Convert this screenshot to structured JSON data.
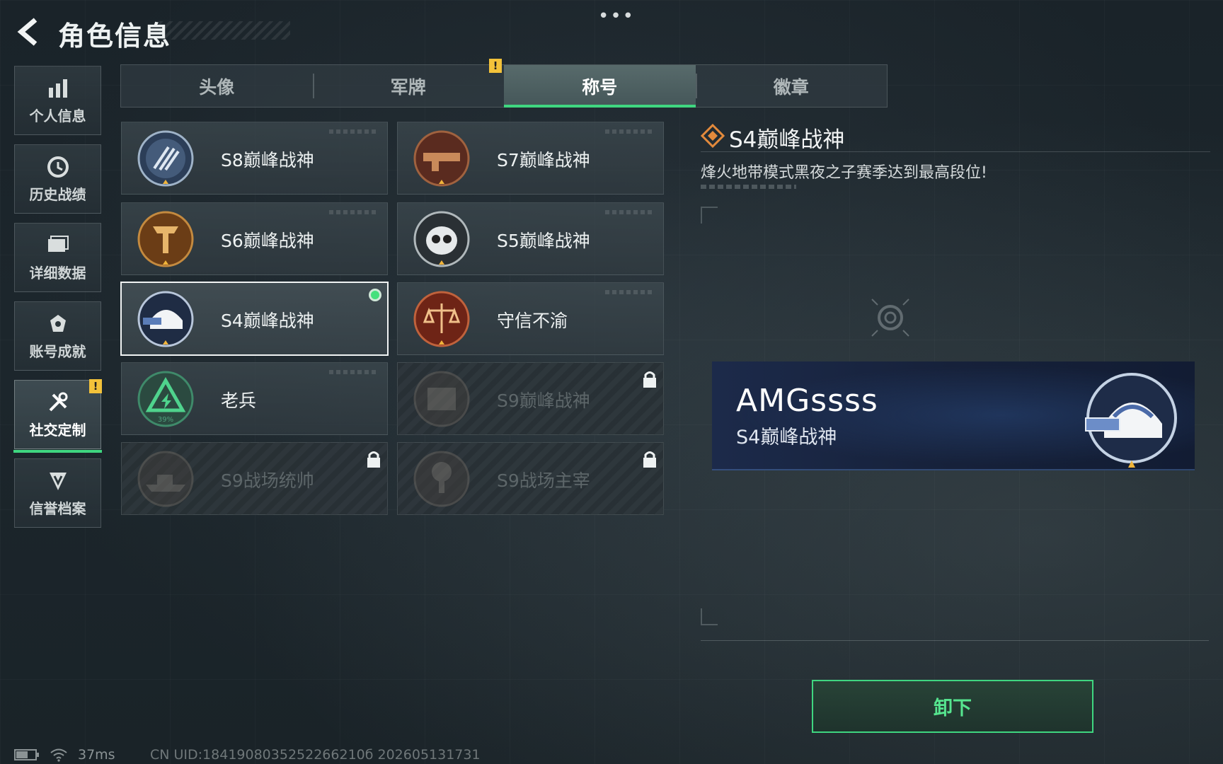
{
  "header": {
    "title": "角色信息",
    "more": "•••"
  },
  "side_nav": [
    {
      "label": "个人信息",
      "icon": "bar-chart-icon",
      "active": false
    },
    {
      "label": "历史战绩",
      "icon": "clock-icon",
      "active": false
    },
    {
      "label": "详细数据",
      "icon": "folder-icon",
      "active": false
    },
    {
      "label": "账号成就",
      "icon": "achievement-icon",
      "active": false
    },
    {
      "label": "社交定制",
      "icon": "tools-icon",
      "active": true,
      "alert": "!"
    },
    {
      "label": "信誉档案",
      "icon": "shield-icon",
      "active": false
    }
  ],
  "tabs": [
    {
      "label": "头像",
      "active": false
    },
    {
      "label": "军牌",
      "active": false,
      "alert": "!"
    },
    {
      "label": "称号",
      "active": true
    },
    {
      "label": "徽章",
      "active": false
    }
  ],
  "titles": [
    {
      "name": "S8巅峰战神",
      "emblem": "s8-emblem",
      "locked": false,
      "selected": false
    },
    {
      "name": "S7巅峰战神",
      "emblem": "s7-emblem",
      "locked": false,
      "selected": false
    },
    {
      "name": "S6巅峰战神",
      "emblem": "s6-emblem",
      "locked": false,
      "selected": false
    },
    {
      "name": "S5巅峰战神",
      "emblem": "s5-emblem",
      "locked": false,
      "selected": false
    },
    {
      "name": "S4巅峰战神",
      "emblem": "s4-emblem",
      "locked": false,
      "selected": true,
      "equipped": true
    },
    {
      "name": "守信不渝",
      "emblem": "scales-emblem",
      "locked": false,
      "selected": false
    },
    {
      "name": "老兵",
      "emblem": "veteran-emblem",
      "locked": false,
      "selected": false,
      "emblem_text": "39%"
    },
    {
      "name": "S9巅峰战神",
      "emblem": "s9-emblem",
      "locked": true,
      "selected": false
    },
    {
      "name": "S9战场统帅",
      "emblem": "s9-commander-emblem",
      "locked": true,
      "selected": false
    },
    {
      "name": "S9战场主宰",
      "emblem": "s9-dominator-emblem",
      "locked": true,
      "selected": false
    }
  ],
  "detail": {
    "title": "S4巅峰战神",
    "description": "烽火地带模式黑夜之子赛季达到最高段位!"
  },
  "banner": {
    "player_name": "AMGssss",
    "title": "S4巅峰战神"
  },
  "actions": {
    "unequip_label": "卸下"
  },
  "status": {
    "ping": "37ms",
    "uid": "CN UID:1841908035252266210б 202605131731"
  },
  "colors": {
    "accent_green": "#3fd680",
    "warn_yellow": "#f3c23a",
    "equipped_dot": "#45e07d"
  }
}
